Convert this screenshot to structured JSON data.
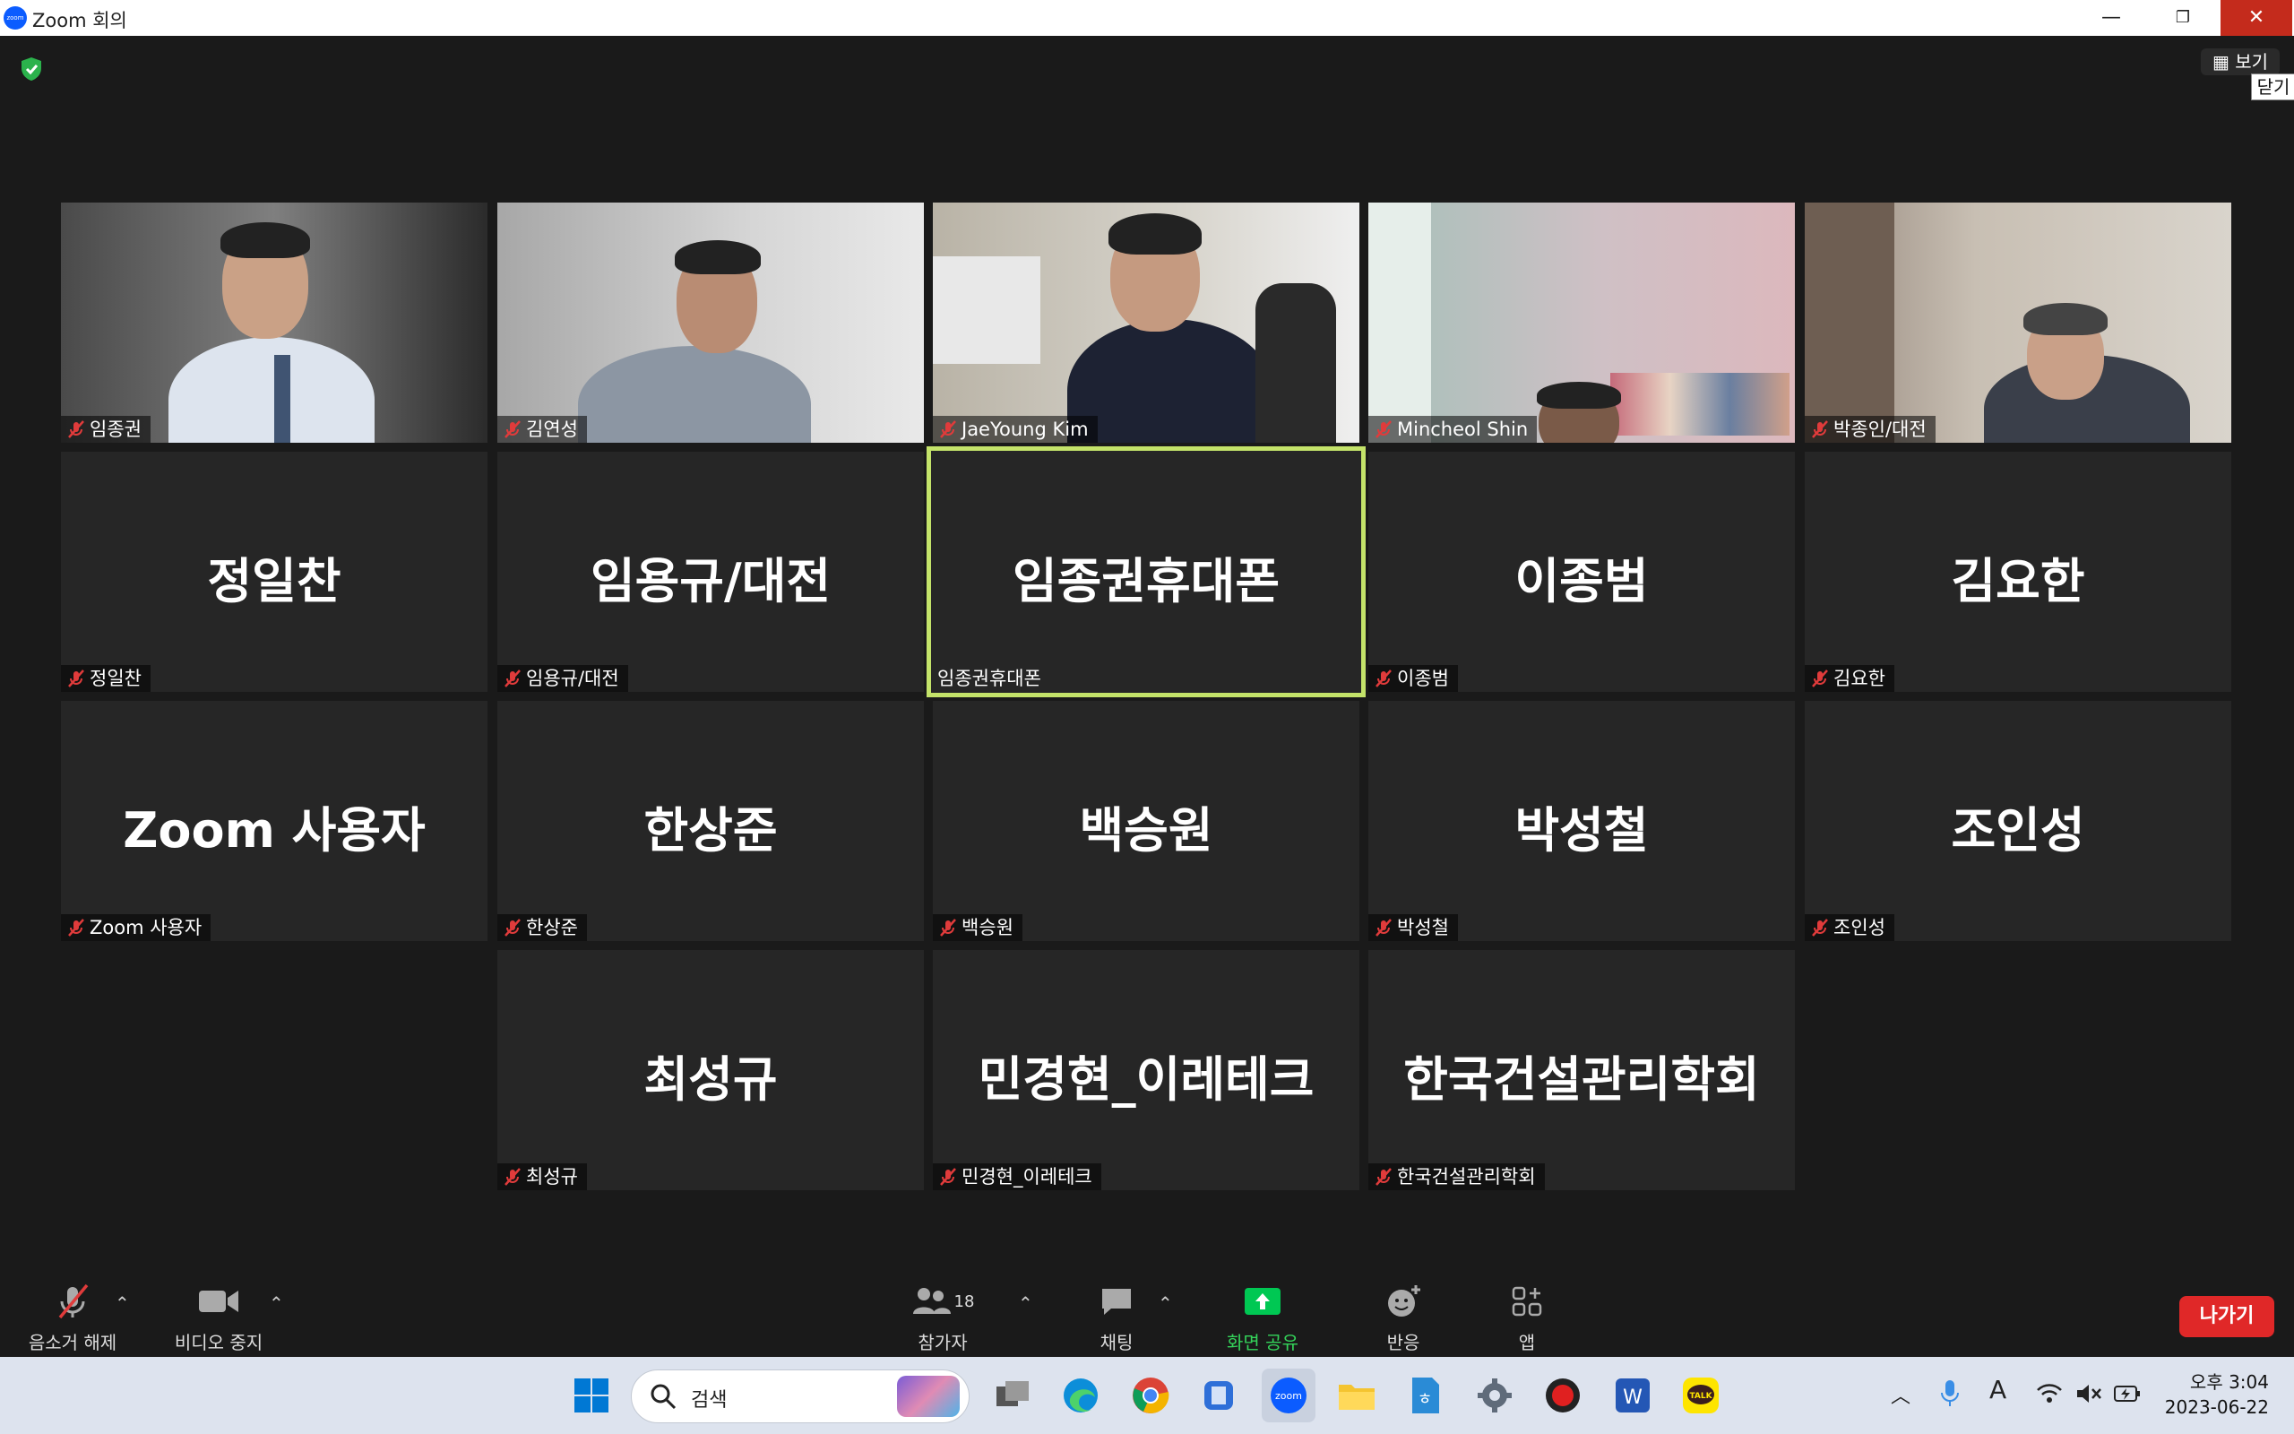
{
  "window": {
    "title": "Zoom 회의",
    "logo_text": "zoom"
  },
  "view_button": "보기",
  "tooltip": "닫기",
  "tiles": [
    {
      "name": "임종권",
      "type": "video",
      "muted": true
    },
    {
      "name": "김연성",
      "type": "video",
      "muted": true
    },
    {
      "name": "JaeYoung Kim",
      "type": "video",
      "muted": true
    },
    {
      "name": "Mincheol Shin",
      "type": "video",
      "muted": true
    },
    {
      "name": "박종인/대전",
      "type": "video",
      "muted": true
    },
    {
      "display": "정일찬",
      "name": "정일찬",
      "muted": true
    },
    {
      "display": "임용규/대전",
      "name": "임용규/대전",
      "muted": true
    },
    {
      "display": "임종권휴대폰",
      "name": "임종권휴대폰",
      "muted": false,
      "active": true
    },
    {
      "display": "이종범",
      "name": "이종범",
      "muted": true
    },
    {
      "display": "김요한",
      "name": "김요한",
      "muted": true
    },
    {
      "display": "Zoom 사용자",
      "name": "Zoom 사용자",
      "muted": true
    },
    {
      "display": "한상준",
      "name": "한상준",
      "muted": true
    },
    {
      "display": "백승원",
      "name": "백승원",
      "muted": true
    },
    {
      "display": "박성철",
      "name": "박성철",
      "muted": true
    },
    {
      "display": "조인성",
      "name": "조인성",
      "muted": true
    },
    {
      "display": "최성규",
      "name": "최성규",
      "muted": true
    },
    {
      "display": "민경현_이레테크",
      "name": "민경현_이레테크",
      "muted": true
    },
    {
      "display": "한국건설관리학회",
      "name": "한국건설관리학회",
      "muted": true
    }
  ],
  "toolbar": {
    "unmute": "음소거 해제",
    "stop_video": "비디오 중지",
    "participants": "참가자",
    "participants_count": "18",
    "chat": "채팅",
    "share_screen": "화면 공유",
    "reactions": "반응",
    "apps": "앱",
    "leave": "나가기"
  },
  "taskbar": {
    "search": "검색",
    "time": "오후 3:04",
    "date": "2023-06-22",
    "tray_font": "A",
    "kakao": "TALK"
  },
  "colors": {
    "active_border": "#c4e36a",
    "share_green": "#00c853",
    "leave_red": "#e02828"
  }
}
